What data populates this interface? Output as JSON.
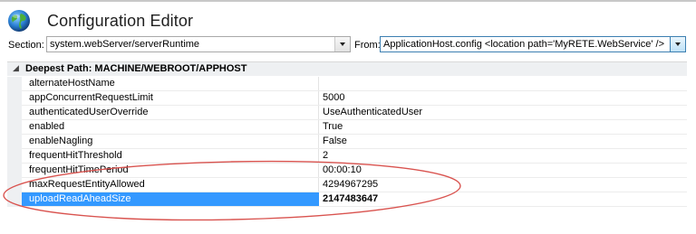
{
  "header": {
    "title": "Configuration Editor",
    "icon": "globe-icon"
  },
  "section_bar": {
    "section_label": "Section:",
    "section_value": "system.webServer/serverRuntime",
    "from_label": "From:",
    "from_value": "ApplicationHost.config <location path='MyRETE.WebService' />"
  },
  "grid": {
    "group_header": "Deepest Path: MACHINE/WEBROOT/APPHOST",
    "rows": [
      {
        "name": "alternateHostName",
        "value": ""
      },
      {
        "name": "appConcurrentRequestLimit",
        "value": "5000"
      },
      {
        "name": "authenticatedUserOverride",
        "value": "UseAuthenticatedUser"
      },
      {
        "name": "enabled",
        "value": "True"
      },
      {
        "name": "enableNagling",
        "value": "False"
      },
      {
        "name": "frequentHitThreshold",
        "value": "2"
      },
      {
        "name": "frequentHitTimePeriod",
        "value": "00:00:10"
      },
      {
        "name": "maxRequestEntityAllowed",
        "value": "4294967295"
      },
      {
        "name": "uploadReadAheadSize",
        "value": "2147483647",
        "selected": true
      }
    ]
  },
  "colors": {
    "selection": "#3399ff",
    "annotation_ellipse": "#d9534f"
  }
}
